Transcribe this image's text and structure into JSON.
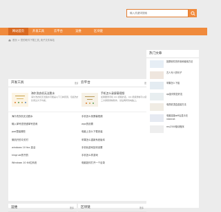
{
  "search": {
    "placeholder": "输入关键词搜索"
  },
  "nav": {
    "items": [
      {
        "label": "网站首页",
        "active": true
      },
      {
        "label": "开发工具",
        "active": false
      },
      {
        "label": "云平台",
        "active": false
      },
      {
        "label": "运维",
        "active": false
      },
      {
        "label": "区块链",
        "active": false
      }
    ]
  },
  "breadcrumb": {
    "text": "首页 > 您的软件下载工具_电子文件库站"
  },
  "dev_tools": {
    "title": "开发工具",
    "more": "更多",
    "feature": {
      "title": "海尔洗衣机无法脱水",
      "desc": "海尔洗衣机无法脱水可能是以下几种原因，包括洗衣机的负荷过大不均衡。"
    },
    "items": [
      "海尔洗衣机无法脱水",
      "输入单号查快递单号查询",
      "pad里装哪些",
      "微机开的中关村",
      "windows 10 fax 激活",
      "kingrust的书的",
      "Windows 10 64位系统"
    ]
  },
  "cloud": {
    "title": "云平台",
    "more": "更多",
    "feature": {
      "title": "手机怎么录屏幕视频",
      "desc": "如果要录手机 QQ 视频的话，QQ 视频录制可以使用第三方屏幕录制软件，然后再转到电脑上。"
    },
    "items": [
      "手机怎么录屏幕视频",
      "wps的设置",
      "电脑上怎么下载安装",
      "苹果怎么重新系统版本",
      "手机玩游戏如何设置",
      "手机怎么样游戏",
      "电脑如何打开一个目录"
    ]
  },
  "hot": {
    "title": "热门文章",
    "items": [
      "投屏软件的作用和使用方法",
      "古人写人的句子",
      "苹果怎么下载",
      "qq如何恢复好友",
      "电视机顶盒连接方法",
      "电脑连接wifi后显示无internet",
      "ms2300驱动程序"
    ]
  },
  "ops": {
    "title": "运维",
    "more": "更多"
  },
  "blockchain": {
    "title": "区块链",
    "more": "更多"
  }
}
